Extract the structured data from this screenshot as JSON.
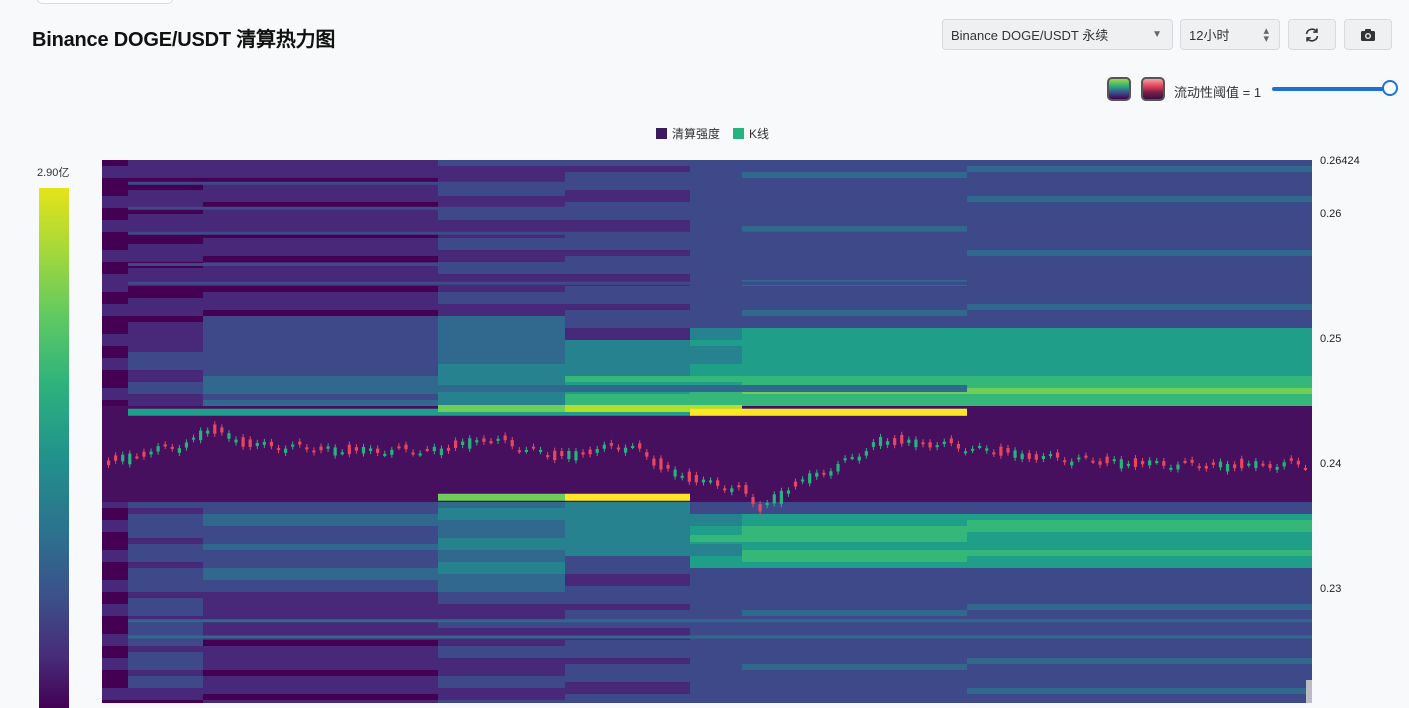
{
  "title": "Binance DOGE/USDT 清算热力图",
  "controls": {
    "pair_select": "Binance DOGE/USDT 永续",
    "pair_select_icon": "caret-down-icon",
    "timeframe_select": "12小时",
    "timeframe_select_icon": "up-down-arrows-icon",
    "refresh_icon": "refresh-icon",
    "screenshot_icon": "camera-icon"
  },
  "threshold": {
    "label": "流动性阈值 = 1",
    "value": 1,
    "slider_level": 1.0,
    "swatch_viridis_icon": "viridis-palette-icon",
    "swatch_red_icon": "red-palette-icon"
  },
  "colors": {
    "background": "#f8f9fa",
    "heatmap_low": "#440154",
    "heatmap_high": "#e4e419",
    "candle_up": "#26b47e",
    "candle_down": "#e8475d",
    "accent": "#1a72d8"
  },
  "chart_data": {
    "type": "heatmap",
    "legend": [
      {
        "name": "清算强度",
        "color": "#3b1a5e"
      },
      {
        "name": "K线",
        "color": "#26b47e"
      }
    ],
    "colorbar": {
      "max_label": "2.90亿",
      "palette": "viridis"
    },
    "y_axis": {
      "top_label": "0.26424",
      "ticks": [
        "0.26",
        "0.25",
        "0.24",
        "0.23"
      ],
      "range": [
        0.2216,
        0.26424
      ]
    },
    "time_segments": 6,
    "liquidation_bands": [
      {
        "segment_from": 0,
        "segment_to": 5,
        "price": 0.2441,
        "intensity": 0.55
      },
      {
        "segment_from": 2,
        "segment_to": 3,
        "price": 0.2444,
        "intensity": 0.75
      },
      {
        "segment_from": 3,
        "segment_to": 4,
        "price": 0.2444,
        "intensity": 0.85
      },
      {
        "segment_from": 4,
        "segment_to": 5,
        "price": 0.2441,
        "intensity": 1.0
      },
      {
        "segment_from": 2,
        "segment_to": 2,
        "price": 0.2373,
        "intensity": 0.8
      },
      {
        "segment_from": 3,
        "segment_to": 3,
        "price": 0.2373,
        "intensity": 1.0
      },
      {
        "segment_from": 4,
        "segment_to": 5,
        "price": 0.234,
        "intensity": 0.65
      },
      {
        "segment_from": 1,
        "segment_to": 5,
        "price": 0.246,
        "intensity": 0.35
      }
    ],
    "candles_summary": {
      "start_price": 0.24,
      "high_price": 0.243,
      "low_price": 0.2364,
      "end_price": 0.2399,
      "count": 170
    }
  }
}
